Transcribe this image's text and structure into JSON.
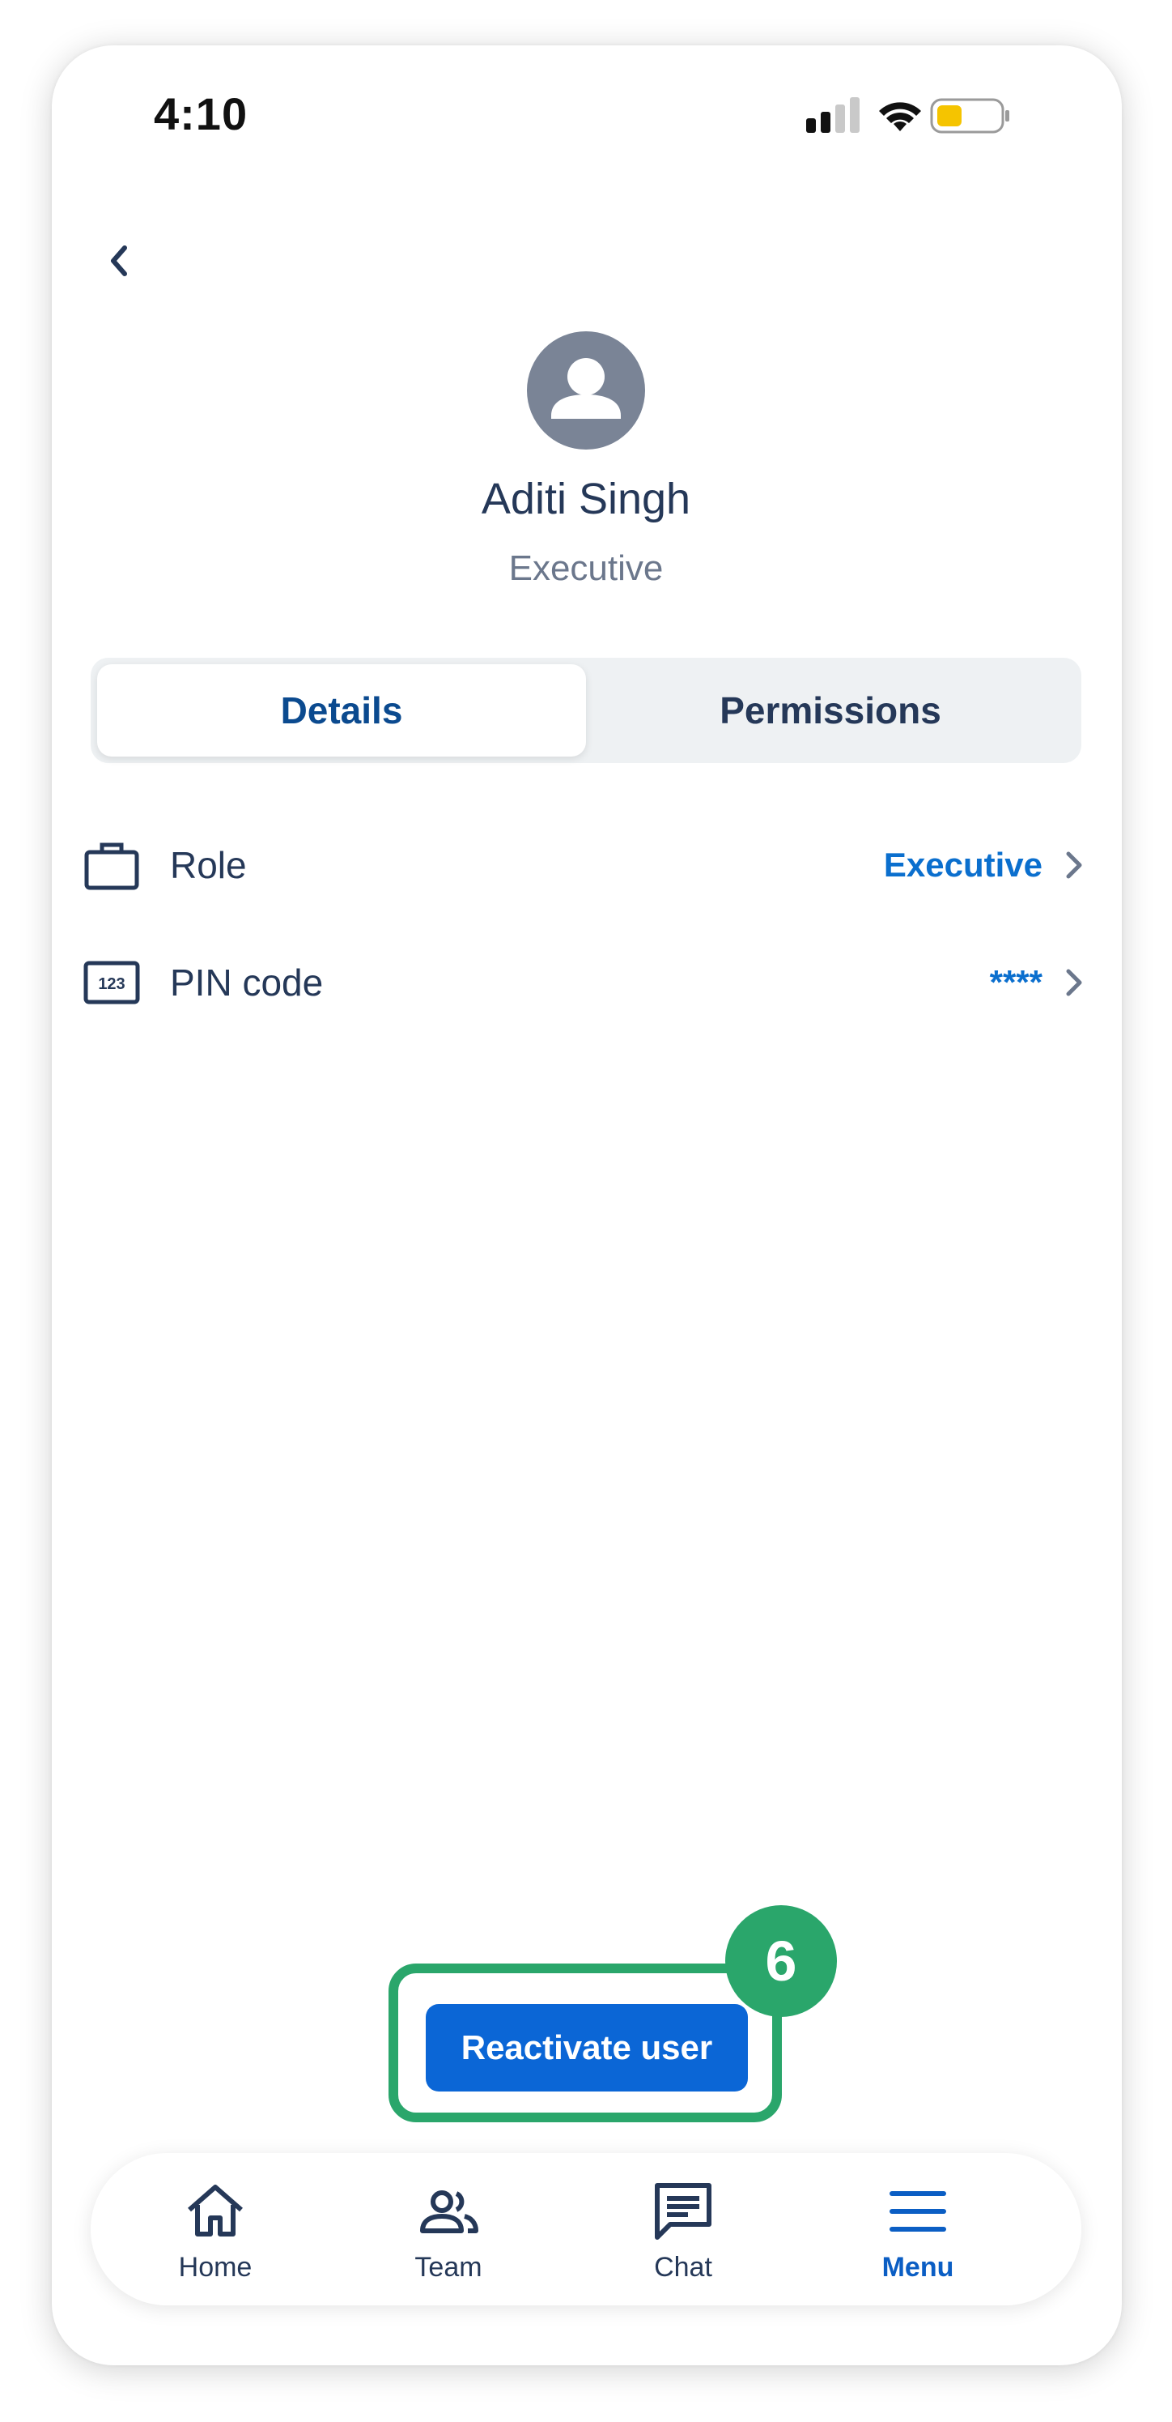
{
  "status_bar": {
    "time": "4:10"
  },
  "profile": {
    "name": "Aditi Singh",
    "role": "Executive"
  },
  "segments": {
    "details": "Details",
    "permissions": "Permissions"
  },
  "rows": [
    {
      "icon": "briefcase-icon",
      "label": "Role",
      "value": "Executive"
    },
    {
      "icon": "pin-code-icon",
      "label": "PIN code",
      "value": "****"
    }
  ],
  "action": {
    "label": "Reactivate user",
    "step_badge": "6"
  },
  "tabbar": [
    {
      "icon": "home-icon",
      "label": "Home"
    },
    {
      "icon": "team-icon",
      "label": "Team"
    },
    {
      "icon": "chat-icon",
      "label": "Chat"
    },
    {
      "icon": "menu-icon",
      "label": "Menu",
      "active": true
    }
  ],
  "colors": {
    "primary": "#0b66d6",
    "highlight": "#2aa66b",
    "text": "#253858",
    "battery": "#f5c400"
  }
}
